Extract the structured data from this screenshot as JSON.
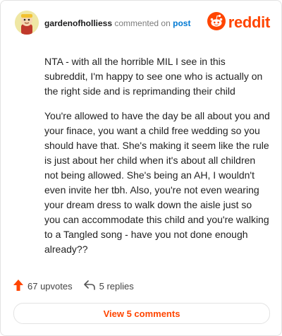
{
  "comment": {
    "username": "gardenofholliess",
    "commented_on": "commented on",
    "post_link": "post",
    "paragraphs": [
      "NTA - with all the horrible MIL I see in this subreddit, I'm happy to see one who is actually on the right side and is reprimanding their child",
      "You're allowed to have the day be all about you and your finace, you want a child free wedding so you should have that. She's making it seem like the rule is just about her child when it's about all children not being allowed. She's being an AH, I wouldn't even invite her tbh. Also, you're not even wearing your dream dress to walk down the aisle just so you can accommodate this child and you're walking to a Tangled song - have you not done enough already??"
    ]
  },
  "brand": {
    "name": "reddit",
    "color": "#ff4500"
  },
  "actions": {
    "upvotes": "67 upvotes",
    "replies": "5 replies"
  },
  "footer": {
    "view_comments": "View 5 comments"
  },
  "icons": {
    "avatar": "snoo-avatar-icon",
    "logo": "reddit-alien-icon",
    "upvote": "upvote-arrow-icon",
    "reply": "reply-arrow-icon"
  }
}
